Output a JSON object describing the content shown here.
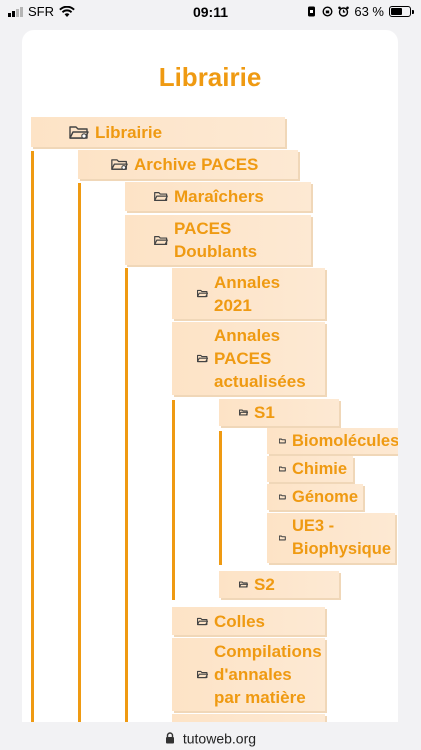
{
  "status_bar": {
    "carrier": "SFR",
    "time": "09:11",
    "battery_percent": "63 %",
    "battery_level": 0.63
  },
  "page": {
    "title": "Librairie"
  },
  "tree": {
    "librairie": "Librairie",
    "archive_paces": "Archive PACES",
    "maraichers": "Maraîchers",
    "paces_doublants": "PACES\nDoublants",
    "annales_2021": "Annales\n2021",
    "annales_paces_actualisees": "Annales\nPACES\nactualisées",
    "s1": "S1",
    "biomolecules": "Biomolécules",
    "chimie": "Chimie",
    "genome": "Génome",
    "ue3_biophysique": "UE3 -\nBiophysique",
    "s2": "S2",
    "colles": "Colles",
    "compilations": "Compilations\nd'annales\npar matière"
  },
  "colors": {
    "accent": "#ef9a12",
    "node_bg": "#fde3c6"
  },
  "browser": {
    "url": "tutoweb.org"
  }
}
